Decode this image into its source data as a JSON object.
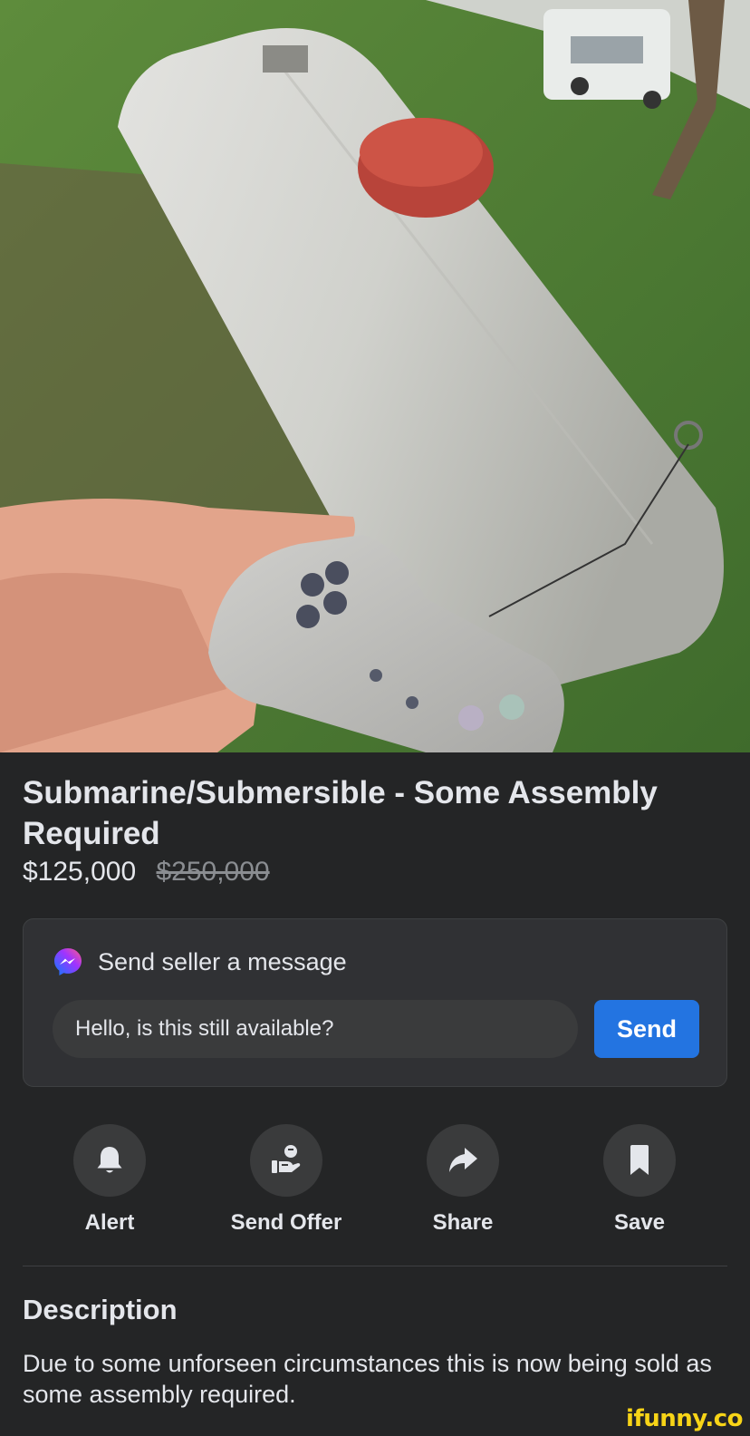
{
  "listing": {
    "title": "Submarine/Submersible - Some Assembly Required",
    "price": "$125,000",
    "original_price": "$250,000"
  },
  "message": {
    "header": "Send seller a message",
    "icon": "messenger-icon",
    "input_value": "Hello, is this still available?",
    "send_label": "Send"
  },
  "actions": [
    {
      "label": "Alert",
      "icon": "bell-icon"
    },
    {
      "label": "Send Offer",
      "icon": "offer-icon"
    },
    {
      "label": "Share",
      "icon": "share-icon"
    },
    {
      "label": "Save",
      "icon": "bookmark-icon"
    }
  ],
  "description": {
    "heading": "Description",
    "text": "Due to some unforseen circumstances this is now being sold as some assembly required."
  },
  "watermark": "ifunny.co",
  "colors": {
    "background": "#242526",
    "card": "#303134",
    "accent": "#2374e1",
    "text": "#e4e6eb",
    "muted": "#8a8d91"
  }
}
